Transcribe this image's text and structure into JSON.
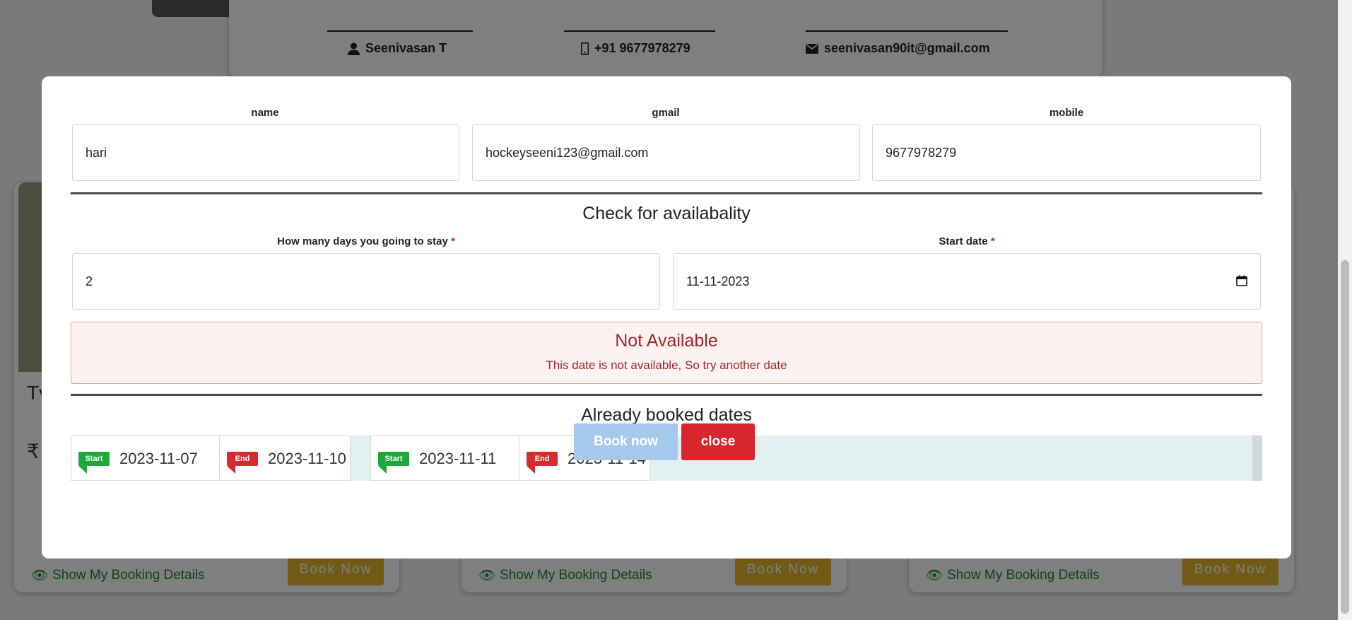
{
  "background": {
    "owner": {
      "name": "Seenivasan T",
      "phone": "+91 9677978279",
      "email": "seenivasan90it@gmail.com"
    },
    "cards": [
      {
        "details_link": "Show My Booking Details",
        "book_button": "Book Now"
      },
      {
        "details_link": "Show My Booking Details",
        "book_button": "Book Now"
      },
      {
        "details_link": "Show My Booking Details",
        "book_button": "Book Now"
      }
    ],
    "fragments": {
      "t": "Tv",
      "rupee": "₹"
    }
  },
  "modal": {
    "fields": {
      "name": {
        "label": "name",
        "value": "hari"
      },
      "gmail": {
        "label": "gmail",
        "value": "hockeyseeni123@gmail.com"
      },
      "mobile": {
        "label": "mobile",
        "value": "9677978279"
      }
    },
    "availability": {
      "title": "Check for availabality",
      "days_label": "How many days you going to stay",
      "days_value": "2",
      "start_label": "Start date",
      "start_value": "11-11-2023",
      "required_mark": "*"
    },
    "alert": {
      "title": "Not Available",
      "message": "This date is not available, So try another date"
    },
    "booked": {
      "title": "Already booked dates",
      "ranges": [
        {
          "start_tag": "Start",
          "start": "2023-11-07",
          "end_tag": "End",
          "end": "2023-11-10"
        },
        {
          "start_tag": "Start",
          "start": "2023-11-11",
          "end_tag": "End",
          "end": "2023-11-14"
        }
      ]
    },
    "buttons": {
      "book": "Book now",
      "close": "close"
    }
  },
  "colors": {
    "start_tag": "#1ea73a",
    "end_tag": "#d62b2f",
    "book_button": "#a5c9ec",
    "close_button": "#d7262c",
    "alert_text": "#a02a2a"
  }
}
